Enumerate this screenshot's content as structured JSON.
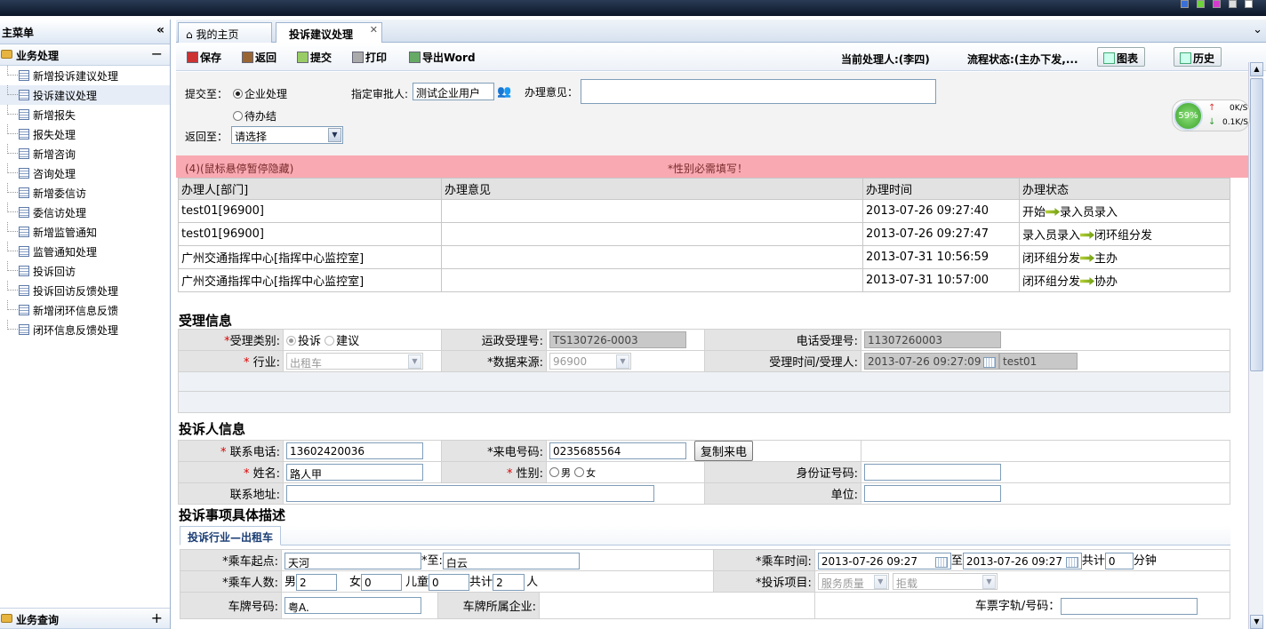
{
  "sidebar": {
    "title": "主菜单",
    "group1": "业务处理",
    "items": [
      "新增投诉建议处理",
      "投诉建议处理",
      "新增报失",
      "报失处理",
      "新增咨询",
      "咨询处理",
      "新增委信访",
      "委信访处理",
      "新增监管通知",
      "监管通知处理",
      "投诉回访",
      "投诉回访反馈处理",
      "新增闭环信息反馈",
      "闭环信息反馈处理"
    ],
    "group2": "业务查询"
  },
  "tabs": [
    "我的主页",
    "投诉建议处理"
  ],
  "toolbar": {
    "save": "保存",
    "back": "返回",
    "submit": "提交",
    "print": "打印",
    "export": "导出Word",
    "handler": "当前处理人:(李四)",
    "flow_status": "流程状态:(主办下发,...",
    "chart": "图表",
    "history": "历史"
  },
  "form": {
    "submit_to": "提交至：",
    "opt1": "企业处理",
    "opt2": "待办结",
    "approver_label": "指定审批人:",
    "approver": "测试企业用户",
    "opinion_label": "办理意见：",
    "return_to": "返回至：",
    "return_value": "请选择"
  },
  "network": {
    "pct": "59%",
    "up": "0K/S",
    "down": "0.1K/S"
  },
  "alert": {
    "left": "(4)(鼠标悬停暂停隐藏)",
    "msg": "*性别必需填写！"
  },
  "history": {
    "headers": [
      "办理人[部门]",
      "办理意见",
      "办理时间",
      "办理状态"
    ],
    "rows": [
      {
        "who": "test01[96900]",
        "op": "",
        "time": "2013-07-26 09:27:40",
        "from": "开始",
        "to": "录入员录入"
      },
      {
        "who": "test01[96900]",
        "op": "",
        "time": "2013-07-26 09:27:47",
        "from": "录入员录入",
        "to": "闭环组分发"
      },
      {
        "who": "广州交通指挥中心[指挥中心监控室]",
        "op": "",
        "time": "2013-07-31 10:56:59",
        "from": "闭环组分发",
        "to": "主办"
      },
      {
        "who": "广州交通指挥中心[指挥中心监控室]",
        "op": "",
        "time": "2013-07-31 10:57:00",
        "from": "闭环组分发",
        "to": "协办"
      }
    ]
  },
  "accept": {
    "title": "受理信息",
    "type_label": "受理类别:",
    "type1": "投诉",
    "type2": "建议",
    "no_label": "运政受理号:",
    "no": "TS130726-0003",
    "tel_no_label": "电话受理号:",
    "tel_no": "11307260003",
    "industry_label": "行业:",
    "industry": "出租车",
    "source_label": "*数据来源:",
    "source": "96900",
    "time_label": "受理时间/受理人:",
    "time": "2013-07-26 09:27:09",
    "user": "test01"
  },
  "complainant": {
    "title": "投诉人信息",
    "phone_label": "联系电话:",
    "phone": "13602420036",
    "incoming_label": "*来电号码:",
    "incoming": "0235685564",
    "copy": "复制来电",
    "name_label": "姓名:",
    "name": "路人甲",
    "gender_label": "性别:",
    "male": "男",
    "female": "女",
    "id_label": "身份证号码:",
    "addr_label": "联系地址:",
    "unit_label": "单位:"
  },
  "desc": {
    "title": "投诉事项具体描述",
    "subtab": "投诉行业—出租车",
    "start_label": "*乘车起点:",
    "start": "天河",
    "to_label": "*至:",
    "end": "白云",
    "time_label": "*乘车时间:",
    "t1": "2013-07-26 09:27",
    "zhi": "至",
    "t2": "2013-07-26 09:27",
    "total": "共计",
    "mins": "0",
    "min_unit": "分钟",
    "count_label": "*乘车人数:",
    "male": "男",
    "m": "2",
    "female": "女",
    "f": "0",
    "child": "儿童",
    "c": "0",
    "sum": "共计",
    "s": "2",
    "ren": "人",
    "item_label": "*投诉项目:",
    "item1": "服务质量",
    "item2": "拒载",
    "plate_label": "车牌号码:",
    "plate": "粤A.",
    "company_label": "车牌所属企业:",
    "ticket_label": "车票字轨/号码："
  }
}
